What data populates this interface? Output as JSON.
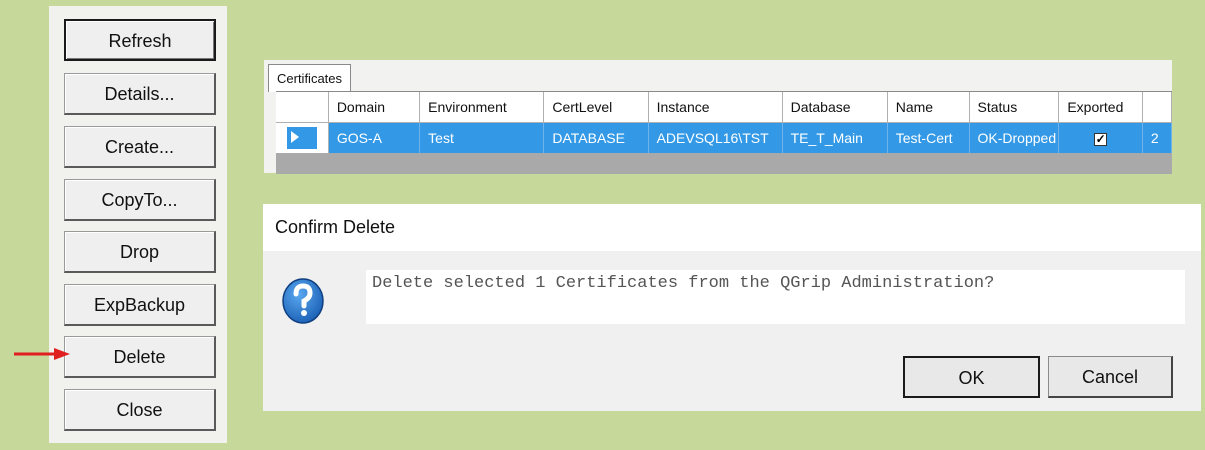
{
  "side_buttons": [
    {
      "label": "Refresh"
    },
    {
      "label": "Details..."
    },
    {
      "label": "Create..."
    },
    {
      "label": "CopyTo..."
    },
    {
      "label": "Drop"
    },
    {
      "label": "ExpBackup"
    },
    {
      "label": "Delete"
    },
    {
      "label": "Close"
    }
  ],
  "annotation": {
    "arrow_color": "#e02020",
    "icon": "red-arrow-right-icon"
  },
  "certificates": {
    "tab_label": "Certificates",
    "columns": [
      "Domain",
      "Environment",
      "CertLevel",
      "Instance",
      "Database",
      "Name",
      "Status",
      "Exported"
    ],
    "row": {
      "domain": "GOS-A",
      "environment": "Test",
      "certlevel": "DATABASE",
      "instance": "ADEVSQL16\\TST",
      "database": "TE_T_Main",
      "name": "Test-Cert",
      "status": "OK-Dropped",
      "exported_checked": true,
      "overflow": "2"
    },
    "selection_color": "#3399e6"
  },
  "dialog": {
    "title": "Confirm Delete",
    "icon": "question-icon",
    "message": "Delete selected 1 Certificates from the QGrip Administration?",
    "ok_label": "OK",
    "cancel_label": "Cancel"
  }
}
